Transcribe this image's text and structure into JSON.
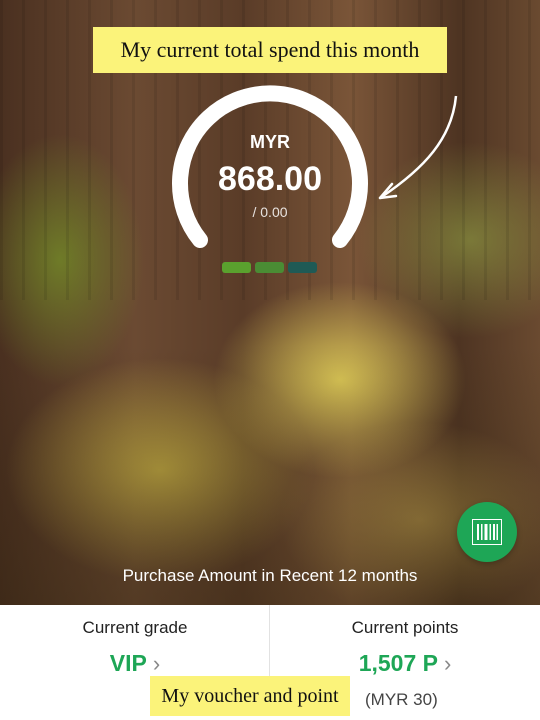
{
  "annotations": {
    "top": "My current total spend this month",
    "bottom": "My voucher and point"
  },
  "gauge": {
    "currency": "MYR",
    "amount": "868.00",
    "target": "/ 0.00"
  },
  "level_segments": [
    {
      "color": "#5aa12e"
    },
    {
      "color": "#4a8c34"
    },
    {
      "color": "#1f5a55"
    }
  ],
  "barcode_button": {
    "icon": "barcode-icon",
    "color": "#1ea656"
  },
  "purchase_label": "Purchase Amount in Recent 12 months",
  "stats": {
    "grade_label": "Current grade",
    "grade_value": "VIP",
    "points_label": "Current points",
    "points_value": "1,507 P",
    "points_sub": "(MYR 30)"
  },
  "colors": {
    "accent": "#1ea656",
    "annotation_bg": "#fbf37a"
  }
}
